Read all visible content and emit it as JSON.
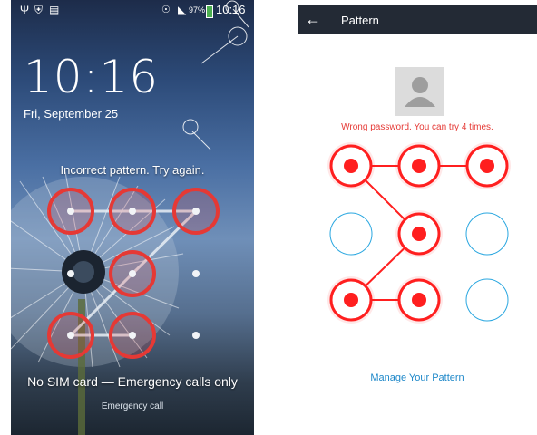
{
  "lockscreen": {
    "status_bar": {
      "battery": "97%",
      "time": "10:16"
    },
    "clock": "10:16",
    "date": "Fri, September 25",
    "message": "Incorrect pattern. Try again.",
    "sim_status": "No SIM card — Emergency calls only",
    "emergency_call": "Emergency call",
    "pattern_path": [
      1,
      2,
      3,
      5,
      7,
      8
    ],
    "error_color": "#e53935"
  },
  "pattern_screen": {
    "title": "Pattern",
    "error_message": "Wrong password. You can try 4 times.",
    "manage_link": "Manage Your Pattern",
    "pattern_path": [
      3,
      2,
      1,
      5,
      7,
      8
    ],
    "error_color": "#ff1f1f",
    "idle_color": "#2aa7e0"
  }
}
